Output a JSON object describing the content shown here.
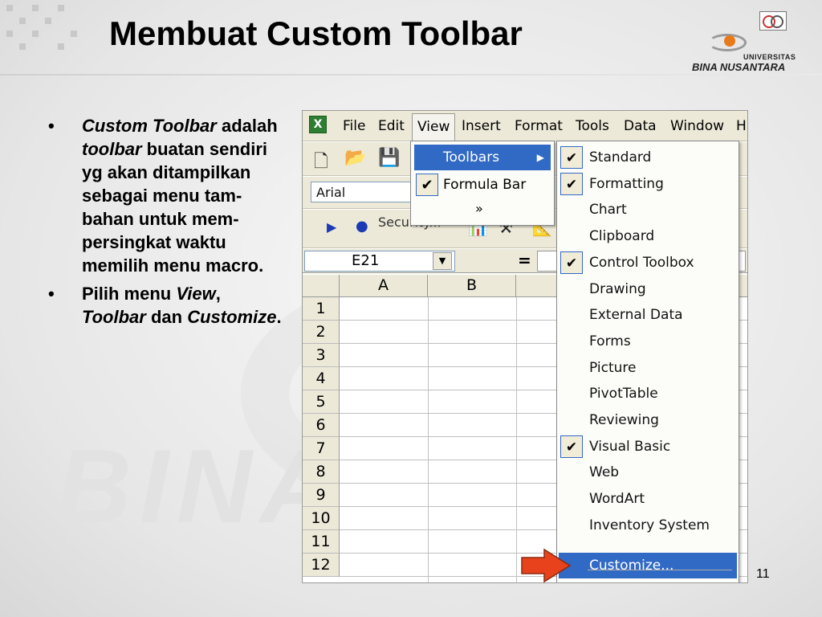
{
  "slide": {
    "title": "Membuat Custom Toolbar",
    "page_number": "11",
    "watermark": "BINA N",
    "logo": {
      "top": "UNIVERSITAS",
      "name": "BINA NUSANTARA"
    }
  },
  "bullets": {
    "b1": {
      "t1": "Custom Toolbar",
      "t2": " adalah ",
      "t3": "toolbar",
      "t4": " buatan sendiri yg akan ditampilkan sebagai menu tam-bahan untuk mem-persingkat waktu memilih menu macro."
    },
    "b2": {
      "t1": "Pilih menu ",
      "t2": "View",
      "t3": ", ",
      "t4": "Toolbar",
      "t5": " dan ",
      "t6": "Customize",
      "t7": "."
    },
    "bullet_symbol": "•"
  },
  "excel": {
    "menubar": [
      "File",
      "Edit",
      "View",
      "Insert",
      "Format",
      "Tools",
      "Data",
      "Window",
      "H"
    ],
    "font_name": "Arial",
    "security_label": "Security...",
    "name_box": "E21",
    "formula_equals": "=",
    "columns": [
      "A",
      "B"
    ],
    "rows": [
      "1",
      "2",
      "3",
      "4",
      "5",
      "6",
      "7",
      "8",
      "9",
      "10",
      "11",
      "12"
    ],
    "view_menu": {
      "items": [
        {
          "label": "Toolbars",
          "checked": false,
          "active": true,
          "arrow": "▶"
        },
        {
          "label": "Formula Bar",
          "checked": true,
          "active": false
        }
      ],
      "expand": "»"
    },
    "toolbars_submenu": [
      {
        "label": "Standard",
        "checked": true
      },
      {
        "label": "Formatting",
        "checked": true
      },
      {
        "label": "Chart",
        "checked": false
      },
      {
        "label": "Clipboard",
        "checked": false
      },
      {
        "label": "Control Toolbox",
        "checked": true
      },
      {
        "label": "Drawing",
        "checked": false
      },
      {
        "label": "External Data",
        "checked": false
      },
      {
        "label": "Forms",
        "checked": false
      },
      {
        "label": "Picture",
        "checked": false
      },
      {
        "label": "PivotTable",
        "checked": false
      },
      {
        "label": "Reviewing",
        "checked": false
      },
      {
        "label": "Visual Basic",
        "checked": true
      },
      {
        "label": "Web",
        "checked": false
      },
      {
        "label": "WordArt",
        "checked": false
      },
      {
        "label": "Inventory System",
        "checked": false
      },
      {
        "label": "Customize...",
        "checked": false,
        "active": true
      }
    ],
    "check_symbol": "✔",
    "colors": {
      "highlight": "#316ac5",
      "arrow": "#e8421c"
    }
  }
}
